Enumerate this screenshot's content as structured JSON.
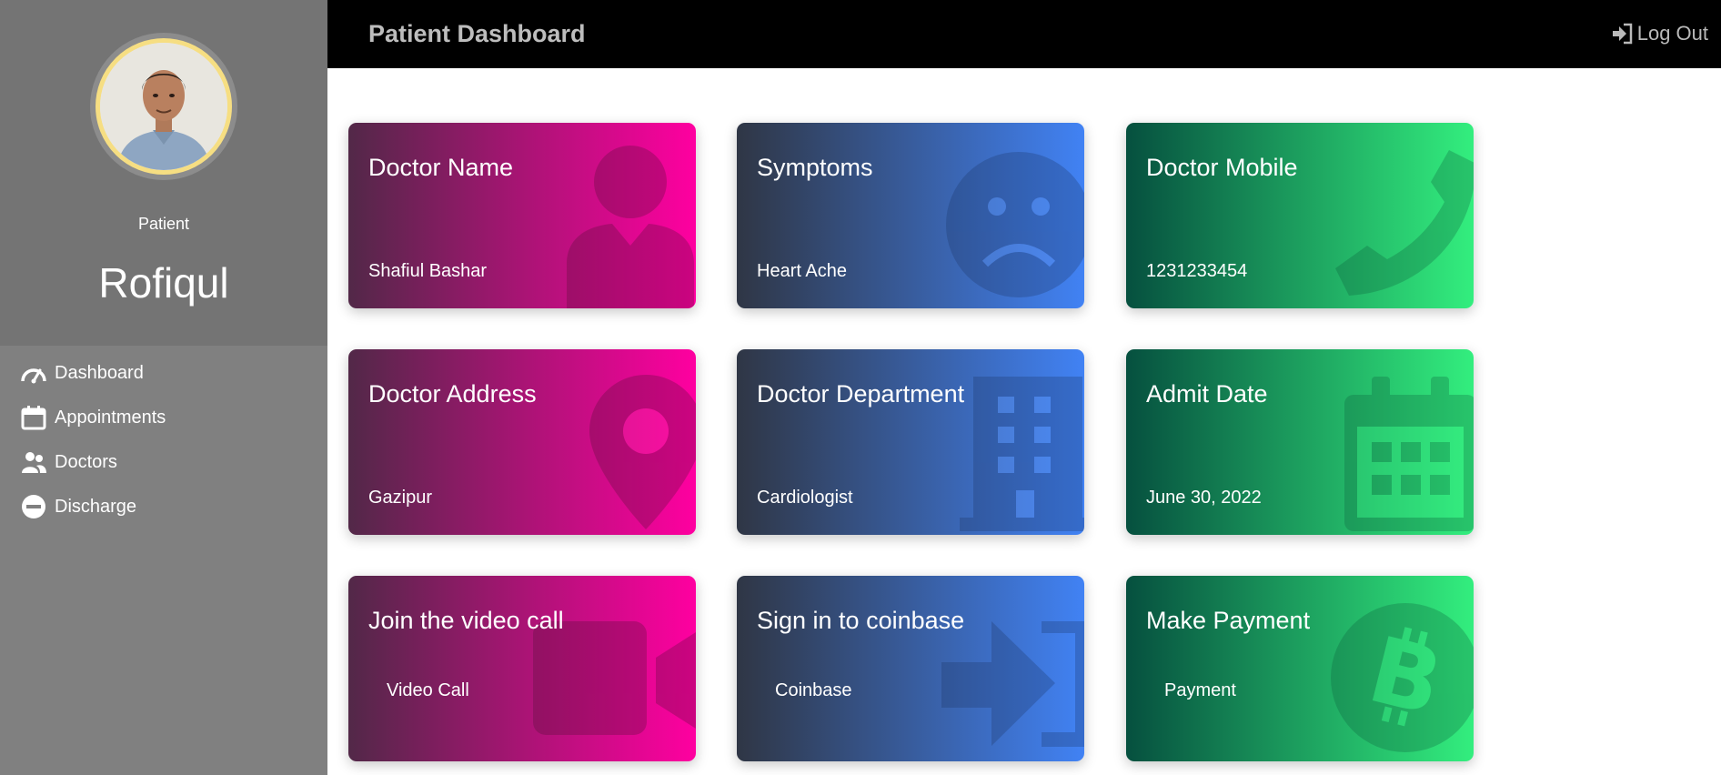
{
  "header": {
    "title": "Patient Dashboard",
    "logout_label": "Log Out"
  },
  "profile": {
    "role": "Patient",
    "name": "Rofiqul"
  },
  "sidebar": {
    "items": [
      {
        "label": "Dashboard",
        "icon": "speedometer-icon"
      },
      {
        "label": "Appointments",
        "icon": "calendar-icon"
      },
      {
        "label": "Doctors",
        "icon": "users-icon"
      },
      {
        "label": "Discharge",
        "icon": "minus-circle-icon"
      }
    ]
  },
  "cards": {
    "doctor_name": {
      "title": "Doctor Name",
      "value": "Shafiul Bashar",
      "icon": "doctor-icon"
    },
    "symptoms": {
      "title": "Symptoms",
      "value": "Heart Ache",
      "icon": "sad-face-icon"
    },
    "doctor_mobile": {
      "title": "Doctor Mobile",
      "value": "1231233454",
      "icon": "phone-icon"
    },
    "doctor_address": {
      "title": "Doctor Address",
      "value": "Gazipur",
      "icon": "map-pin-icon"
    },
    "doctor_department": {
      "title": "Doctor Department",
      "value": "Cardiologist",
      "icon": "building-icon"
    },
    "admit_date": {
      "title": "Admit Date",
      "value": "June 30, 2022",
      "icon": "calendar-icon"
    },
    "video_call": {
      "title": "Join the video call",
      "link": "Video Call",
      "icon": "video-camera-icon"
    },
    "coinbase": {
      "title": "Sign in to coinbase",
      "link": "Coinbase",
      "icon": "sign-in-icon"
    },
    "payment": {
      "title": "Make Payment",
      "link": "Payment",
      "icon": "bitcoin-icon"
    }
  },
  "colors": {
    "pink_gradient": [
      "#522848",
      "#ff00a0"
    ],
    "blue_gradient": [
      "#2f3645",
      "#4182f4"
    ],
    "green_gradient": [
      "#06503f",
      "#33ee7e"
    ],
    "sidebar": "#808080",
    "topbar": "#000000"
  }
}
